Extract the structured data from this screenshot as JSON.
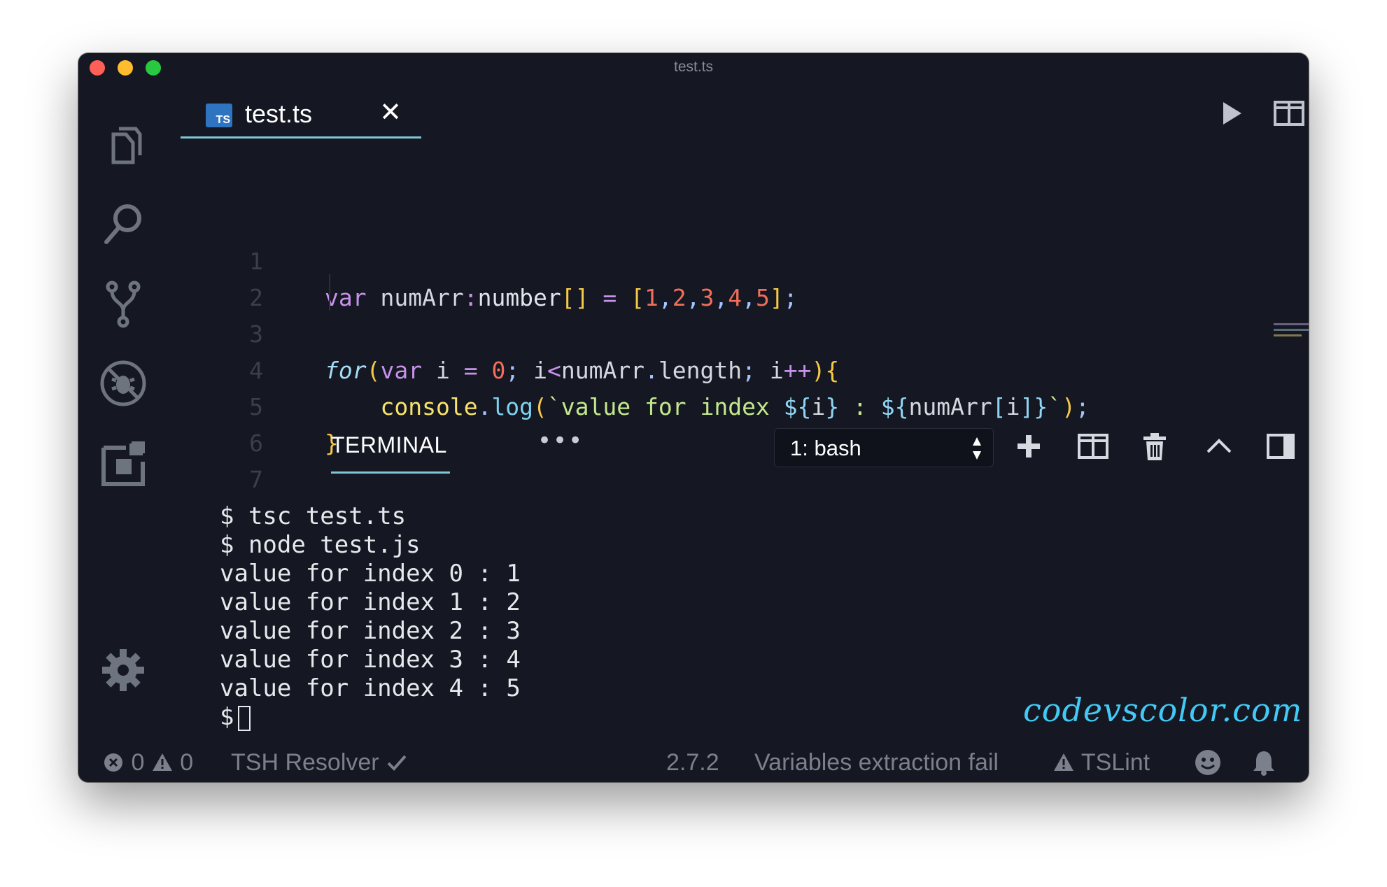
{
  "window": {
    "title": "test.ts"
  },
  "activity_bar": [
    "files-icon",
    "search-icon",
    "source-control-icon",
    "debug-icon",
    "extensions-icon",
    "settings-gear-icon"
  ],
  "editor": {
    "tab": {
      "badge": "TS",
      "label": "test.ts",
      "close": "✕"
    },
    "line_numbers": [
      "1",
      "2",
      "3",
      "4",
      "5",
      "6",
      "7"
    ],
    "code_lines": [
      "var numArr:number[] = [1,2,3,4,5];",
      "",
      "for(var i = 0; i<numArr.length; i++){",
      "    console.log(`value for index ${i} : ${numArr[i]}`);",
      "}",
      "",
      ""
    ],
    "actions": [
      "run-icon",
      "split-editor-icon",
      "more-actions-icon"
    ]
  },
  "panel": {
    "tab": "TERMINAL",
    "more": "•••",
    "terminal_select": "1: bash",
    "actions": [
      "add-terminal-icon",
      "split-terminal-icon",
      "trash-icon",
      "maximize-panel-icon",
      "toggle-sidebar-icon",
      "close-panel-icon"
    ]
  },
  "terminal": {
    "lines": [
      "$ tsc test.ts",
      "$ node test.js",
      "value for index 0 : 1",
      "value for index 1 : 2",
      "value for index 2 : 3",
      "value for index 3 : 4",
      "value for index 4 : 5"
    ],
    "prompt": "$"
  },
  "watermark": "codevscolor.com",
  "statusbar": {
    "errors": "0",
    "warnings": "0",
    "resolver": "TSH Resolver",
    "version": "2.7.2",
    "message": "Variables extraction fail",
    "linter": "TSLint"
  },
  "colors": {
    "background": "#151822",
    "accent": "#7ec7d4",
    "ts_badge": "#2f74c0",
    "watermark": "#42c9f5"
  }
}
